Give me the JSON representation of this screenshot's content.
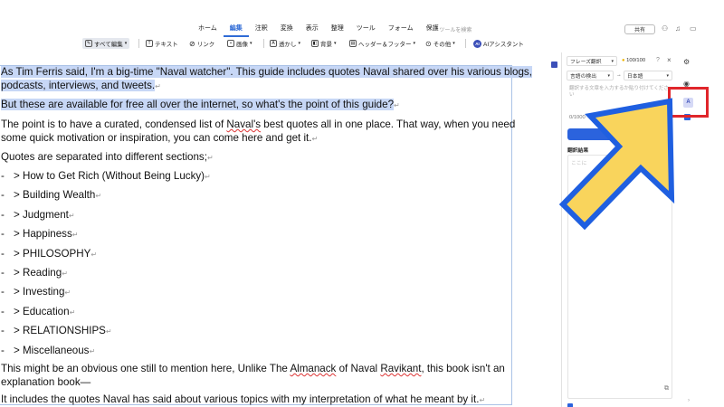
{
  "menu": {
    "items": [
      "ホーム",
      "編集",
      "注釈",
      "変換",
      "表示",
      "整理",
      "ツール",
      "フォーム",
      "保護"
    ],
    "active_index": 1,
    "search_placeholder": "ツールを検索",
    "share_label": "共有"
  },
  "toolbar": {
    "edit_all": "すべて編集",
    "text": "テキスト",
    "link": "リンク",
    "image": "画像",
    "watermark": "透かし",
    "background": "背景",
    "header_footer": "ヘッダー＆フッター",
    "other": "その他",
    "ai_badge": "AI",
    "ai_assistant": "AIアシスタント"
  },
  "document": {
    "p1_line1": "As Tim Ferris said, I'm a big-time \"Naval watcher\". This guide includes quotes Naval shared over his various blogs,",
    "p1_line2": "podcasts, interviews, and tweets.",
    "p2": "But these are available for free all over the internet, so what's the point of this guide?",
    "p3_line1_a": "The point is to have a curated, condensed list of ",
    "p3_line1_b": "Naval's",
    "p3_line1_c": " best quotes all in one place. That way, when you need",
    "p3_line2": "some quick motivation or inspiration, you can come here and get it.",
    "p4": "Quotes are separated into different sections;",
    "sections": [
      "> How to Get Rich (Without Being Lucky)",
      "> Building Wealth",
      "> Judgment",
      "> Happiness",
      "> PHILOSOPHY",
      "> Reading",
      "> Investing",
      "> Education",
      "> RELATIONSHIPS",
      "> Miscellaneous"
    ],
    "bullet": "-",
    "p5_line1_a": "This might be an obvious one still to mention here, Unlike The ",
    "p5_line1_b": "Almanack",
    "p5_line1_c": " of Naval ",
    "p5_line1_d": "Ravikant",
    "p5_line1_e": ", this book isn't an",
    "p5_line2": "explanation book—",
    "p6": "It includes the quotes Naval has said about various topics with my interpretation of what he meant by it.",
    "para_mark": "↵"
  },
  "panel": {
    "mode": "フレーズ翻訳",
    "credits": "100/100",
    "source_lang": "言語の検出",
    "arrow": "→",
    "target_lang": "日本語",
    "input_placeholder": "翻訳する文章を入力するか貼り付けてください",
    "char_count": "0/1000",
    "result_label": "翻訳結果",
    "result_placeholder": "ここに",
    "close": "×"
  },
  "colors": {
    "accent": "#2b63dd",
    "highlight_red": "#e0262b",
    "arrow_fill": "#f9d45c",
    "arrow_stroke": "#1f5fe0",
    "selection": "#c7d7f6"
  }
}
